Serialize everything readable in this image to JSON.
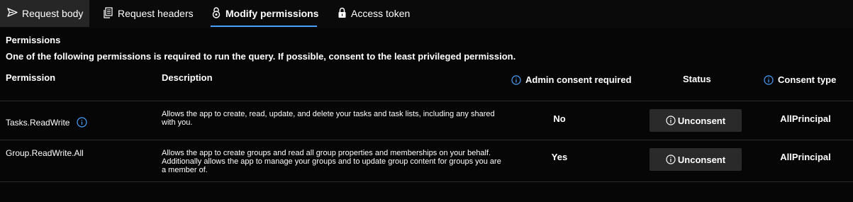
{
  "tabs": [
    {
      "label": "Request body",
      "icon": "send-icon"
    },
    {
      "label": "Request headers",
      "icon": "document-icon"
    },
    {
      "label": "Modify permissions",
      "icon": "lock-settings-icon"
    },
    {
      "label": "Access token",
      "icon": "lock-icon"
    }
  ],
  "active_tab": "Modify permissions",
  "section_title": "Permissions",
  "notice": "One of the following permissions is required to run the query. If possible, consent to the least privileged permission.",
  "headers": {
    "permission": "Permission",
    "description": "Description",
    "admin_consent": "Admin consent required",
    "status": "Status",
    "consent_type": "Consent type"
  },
  "rows": [
    {
      "permission": "Tasks.ReadWrite",
      "has_info": true,
      "description": "Allows the app to create, read, update, and delete your tasks and task lists, including any shared with you.",
      "admin_consent": "No",
      "status_button": "Unconsent",
      "consent_type": "AllPrincipal"
    },
    {
      "permission": "Group.ReadWrite.All",
      "has_info": false,
      "description": "Allows the app to create groups and read all group properties and memberships on your behalf. Additionally allows the app to manage your groups and to update group content for groups you are a member of.",
      "admin_consent": "Yes",
      "status_button": "Unconsent",
      "consent_type": "AllPrincipal"
    }
  ],
  "colors": {
    "accent": "#4aa0ff",
    "background": "#0a0a0a",
    "button": "#2a2a2a"
  }
}
